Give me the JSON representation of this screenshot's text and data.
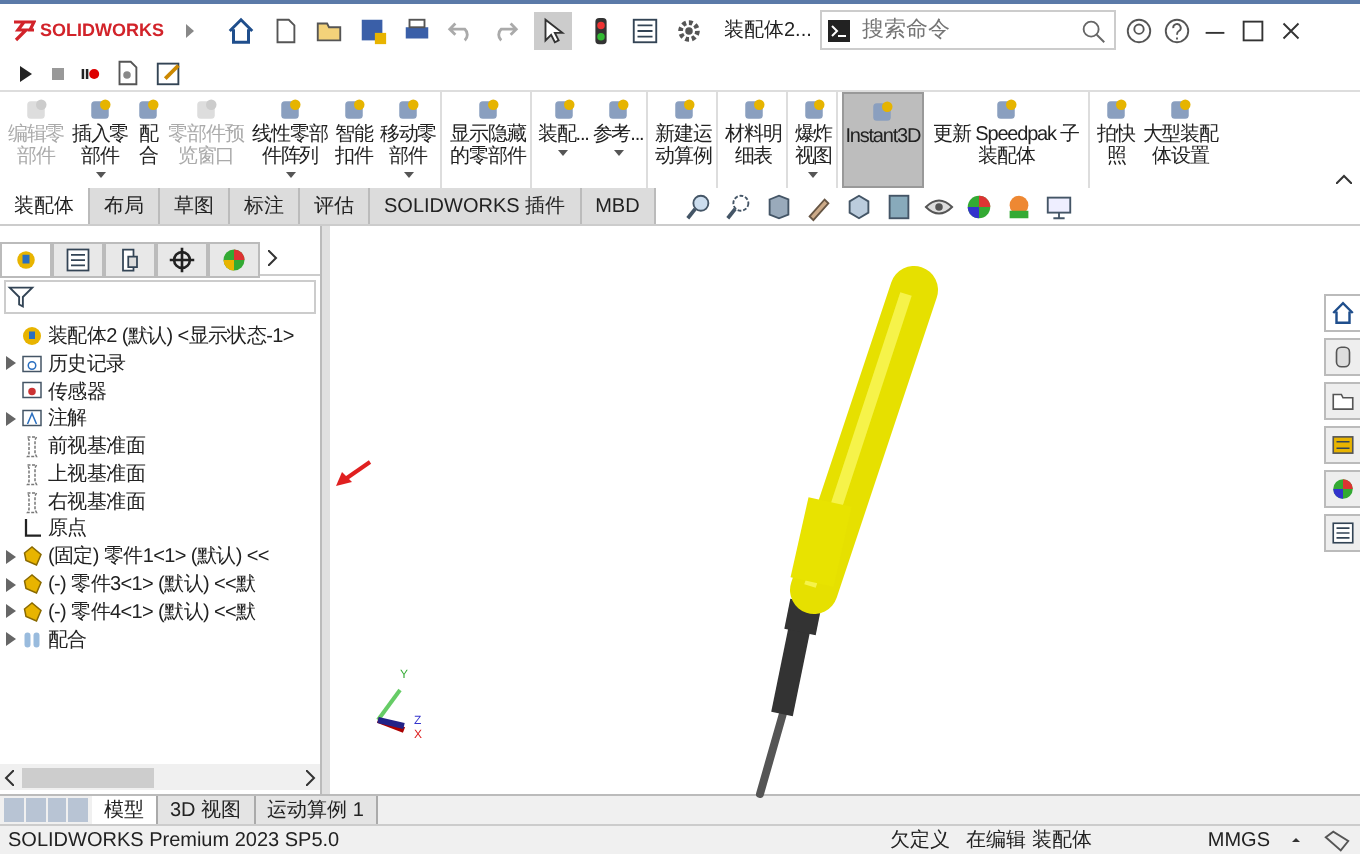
{
  "title_bar": {
    "logo": "SOLIDWORKS",
    "document_title": "装配体2...",
    "search": {
      "placeholder": "搜索命令"
    }
  },
  "ribbon": [
    {
      "label": "编辑零部件",
      "disabled": true,
      "dropdown": false,
      "selected": false,
      "group_end": false
    },
    {
      "label": "插入零部件",
      "disabled": false,
      "dropdown": true,
      "selected": false,
      "group_end": false
    },
    {
      "label": "配合",
      "disabled": false,
      "dropdown": false,
      "selected": false,
      "group_end": false
    },
    {
      "label": "零部件预览窗口",
      "disabled": true,
      "dropdown": false,
      "selected": false,
      "group_end": false
    },
    {
      "label": "线性零部件阵列",
      "disabled": false,
      "dropdown": true,
      "selected": false,
      "group_end": false
    },
    {
      "label": "智能扣件",
      "disabled": false,
      "dropdown": false,
      "selected": false,
      "group_end": false
    },
    {
      "label": "移动零部件",
      "disabled": false,
      "dropdown": true,
      "selected": false,
      "group_end": true
    },
    {
      "label": "显示隐藏的零部件",
      "disabled": false,
      "dropdown": false,
      "selected": false,
      "group_end": true
    },
    {
      "label": "装配...",
      "disabled": false,
      "dropdown": true,
      "selected": false,
      "group_end": false
    },
    {
      "label": "参考...",
      "disabled": false,
      "dropdown": true,
      "selected": false,
      "group_end": true
    },
    {
      "label": "新建运动算例",
      "disabled": false,
      "dropdown": false,
      "selected": false,
      "group_end": true
    },
    {
      "label": "材料明细表",
      "disabled": false,
      "dropdown": false,
      "selected": false,
      "group_end": true
    },
    {
      "label": "爆炸视图",
      "disabled": false,
      "dropdown": true,
      "selected": false,
      "group_end": true
    },
    {
      "label": "Instant3D",
      "disabled": false,
      "dropdown": false,
      "selected": true,
      "group_end": false
    },
    {
      "label": "更新 Speedpak 子装配体",
      "disabled": false,
      "dropdown": false,
      "selected": false,
      "group_end": true
    },
    {
      "label": "拍快照",
      "disabled": false,
      "dropdown": false,
      "selected": false,
      "group_end": false
    },
    {
      "label": "大型装配体设置",
      "disabled": false,
      "dropdown": false,
      "selected": false,
      "group_end": false
    }
  ],
  "command_tabs": [
    {
      "label": "装配体",
      "selected": true
    },
    {
      "label": "布局",
      "selected": false
    },
    {
      "label": "草图",
      "selected": false
    },
    {
      "label": "标注",
      "selected": false
    },
    {
      "label": "评估",
      "selected": false
    },
    {
      "label": "SOLIDWORKS 插件",
      "selected": false
    },
    {
      "label": "MBD",
      "selected": false
    }
  ],
  "feature_tree": {
    "items": [
      {
        "kind": "assembly",
        "label": "装配体2 (默认) <显示状态-1>",
        "has_children": false
      },
      {
        "kind": "folder",
        "label": "历史记录",
        "has_children": true
      },
      {
        "kind": "sensor",
        "label": "传感器",
        "has_children": false
      },
      {
        "kind": "annotation",
        "label": "注解",
        "has_children": true
      },
      {
        "kind": "plane",
        "label": "前视基准面",
        "has_children": false
      },
      {
        "kind": "plane",
        "label": "上视基准面",
        "has_children": false
      },
      {
        "kind": "plane",
        "label": "右视基准面",
        "has_children": false
      },
      {
        "kind": "origin",
        "label": "原点",
        "has_children": false
      },
      {
        "kind": "part",
        "label": "(固定) 零件1<1> (默认) <<",
        "has_children": true
      },
      {
        "kind": "part",
        "label": "(-) 零件3<1> (默认) <<默",
        "has_children": true
      },
      {
        "kind": "part",
        "label": "(-) 零件4<1> (默认) <<默",
        "has_children": true
      },
      {
        "kind": "mates",
        "label": "配合",
        "has_children": true
      }
    ]
  },
  "triad": {
    "x": "X",
    "y": "Y",
    "z": "Z"
  },
  "bottom_tabs": [
    {
      "label": "模型",
      "selected": true
    },
    {
      "label": "3D 视图",
      "selected": false
    },
    {
      "label": "运动算例 1",
      "selected": false
    }
  ],
  "status_bar": {
    "product": "SOLIDWORKS Premium 2023 SP5.0",
    "definition": "欠定义",
    "mode": "在编辑 装配体",
    "units": "MMGS"
  }
}
